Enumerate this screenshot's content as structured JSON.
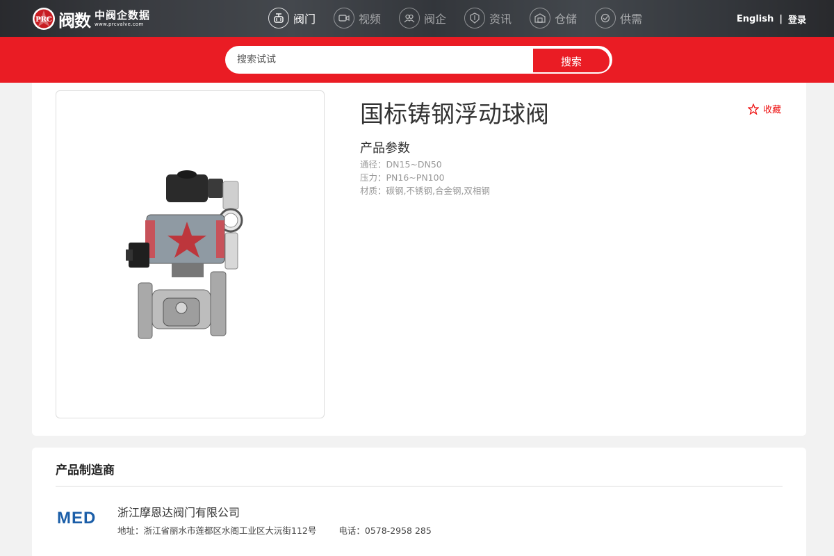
{
  "header": {
    "logo": {
      "main": "阀数",
      "sub_cn": "中阀企数据",
      "sub_url": "www.prcvalve.com",
      "emblem_text": "PRC"
    },
    "nav": [
      {
        "label": "阀门",
        "icon": "valve-icon"
      },
      {
        "label": "视频",
        "icon": "video-icon"
      },
      {
        "label": "阀企",
        "icon": "company-icon"
      },
      {
        "label": "资讯",
        "icon": "news-icon"
      },
      {
        "label": "仓储",
        "icon": "warehouse-icon"
      },
      {
        "label": "供需",
        "icon": "supply-demand-icon"
      }
    ],
    "english": "English",
    "separator": "|",
    "login": "登录"
  },
  "search": {
    "placeholder": "搜索试试",
    "button": "搜索"
  },
  "product": {
    "title": "国标铸钢浮动球阀",
    "favorite": "收藏",
    "params_heading": "产品参数",
    "params": [
      {
        "label": "通径：",
        "value": "DN15~DN50"
      },
      {
        "label": "压力：",
        "value": "PN16~PN100"
      },
      {
        "label": "材质：",
        "value": "碳钢,不锈钢,合金钢,双相钢"
      }
    ]
  },
  "manufacturer": {
    "heading": "产品制造商",
    "logo": "MED",
    "name": "浙江摩恩达阀门有限公司",
    "address": "地址：浙江省丽水市莲都区水阁工业区大沅街112号",
    "phone": "电话：0578-2958 285"
  },
  "colors": {
    "brand_red": "#ea1c24",
    "mfr_blue": "#1b5ea8"
  }
}
